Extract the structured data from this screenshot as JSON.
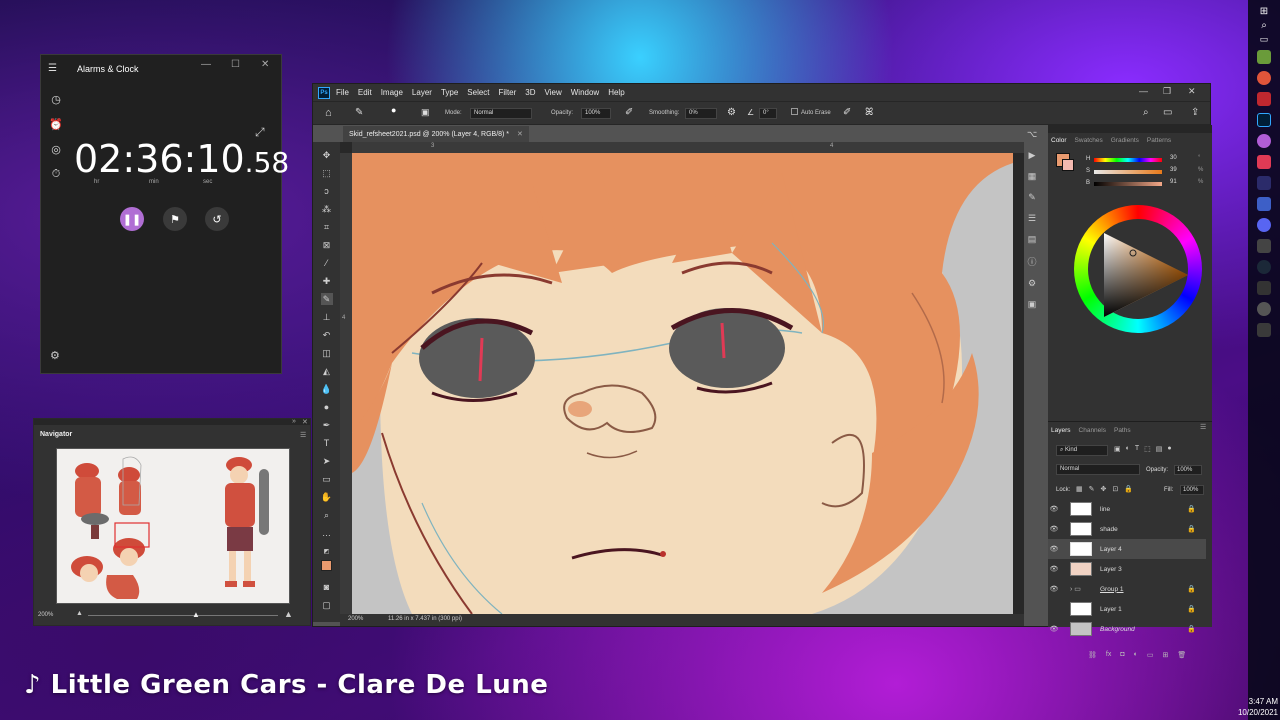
{
  "clock_app": {
    "title": "Alarms & Clock",
    "time_main": "02:36:10",
    "time_ms": ".58",
    "unit_hr": "hr",
    "unit_min": "min",
    "unit_sec": "sec",
    "pause_icon": "pause-icon",
    "lap_icon": "flag-icon",
    "reset_icon": "reset-icon",
    "accent": "#b06ed4"
  },
  "navigator": {
    "title": "Navigator",
    "zoom": "200%"
  },
  "photoshop": {
    "logo": "Ps",
    "menu": [
      "File",
      "Edit",
      "Image",
      "Layer",
      "Type",
      "Select",
      "Filter",
      "3D",
      "View",
      "Window",
      "Help"
    ],
    "options": {
      "mode_label": "Mode:",
      "mode_value": "Normal",
      "opacity_label": "Opacity:",
      "opacity_value": "100%",
      "smoothing_label": "Smoothing:",
      "smoothing_value": "0%",
      "angle_value": "0°",
      "auto_erase": "Auto Erase"
    },
    "doc_tab": "Skid_refsheet2021.psd @ 200% (Layer 4, RGB/8) *",
    "ruler_h_marks": [
      "3",
      "4"
    ],
    "ruler_v_marks": [
      "4"
    ],
    "status": {
      "zoom": "200%",
      "size": "11.26 in x 7.437 in (300 ppi)"
    },
    "color_panel": {
      "tabs": [
        "Color",
        "Swatches",
        "Gradients",
        "Patterns"
      ],
      "h_label": "H",
      "s_label": "S",
      "b_label": "B",
      "h_value": "30",
      "s_value": "39",
      "b_value": "91",
      "h_unit": "°",
      "s_unit": "%",
      "b_unit": "%",
      "foreground": "#e89a6f"
    },
    "layers_panel": {
      "tabs": [
        "Layers",
        "Channels",
        "Paths"
      ],
      "filter": "Kind",
      "blend_mode": "Normal",
      "opacity_label": "Opacity:",
      "opacity_value": "100%",
      "lock_label": "Lock:",
      "fill_label": "Fill:",
      "fill_value": "100%",
      "layers": [
        {
          "name": "line",
          "visible": true,
          "locked": true,
          "selected": false
        },
        {
          "name": "shade",
          "visible": true,
          "locked": true,
          "selected": false
        },
        {
          "name": "Layer 4",
          "visible": true,
          "locked": false,
          "selected": true
        },
        {
          "name": "Layer 3",
          "visible": true,
          "locked": false,
          "selected": false
        },
        {
          "name": "Group 1",
          "visible": true,
          "locked": true,
          "selected": false
        },
        {
          "name": "Layer 1",
          "visible": false,
          "locked": true,
          "selected": false
        },
        {
          "name": "Background",
          "visible": true,
          "locked": true,
          "selected": false
        }
      ]
    }
  },
  "now_playing": "♪ Little Green Cars - Clare De Lune",
  "taskbar": {
    "time": "3:47 AM",
    "date": "10/20/2021"
  }
}
